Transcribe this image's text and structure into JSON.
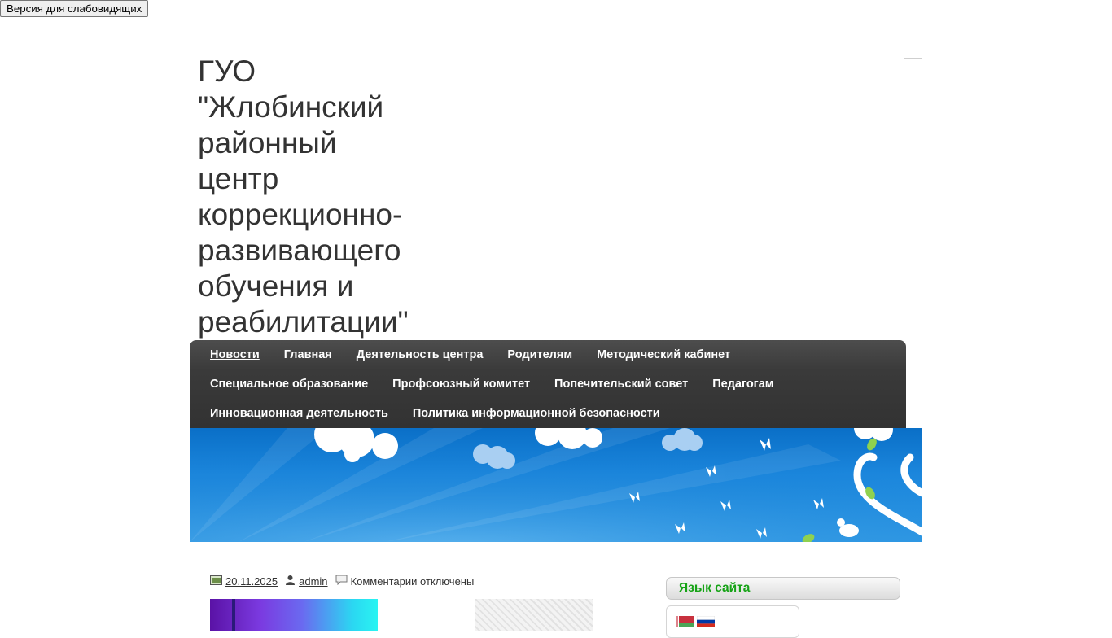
{
  "accessibility_button": "Версия для слабовидящих",
  "site_title": "ГУО\n\"Жлобинский\nрайонный\nцентр\nкоррекционно-\nразвивающего\nобучения и\nреабилитации\"",
  "nav": {
    "row1": [
      "Новости",
      "Главная",
      "Деятельность центра",
      "Родителям",
      "Методический кабинет"
    ],
    "row2": [
      "Специальное образование",
      "Профсоюзный комитет",
      "Попечительский совет",
      "Педагогам"
    ],
    "row3": [
      "Инновационная деятельность",
      "Политика информационной безопасности"
    ],
    "active": "Новости"
  },
  "post_meta": {
    "date": "20.11.2025",
    "author": "admin",
    "comments": "Комментарии отключены"
  },
  "sidebar": {
    "language_widget_title": "Язык сайта",
    "flags": [
      "belarus-flag",
      "russia-flag"
    ]
  },
  "colors": {
    "nav_bg": "#363636",
    "widget_title": "#16a316",
    "banner_sky": "#1b86dc"
  }
}
